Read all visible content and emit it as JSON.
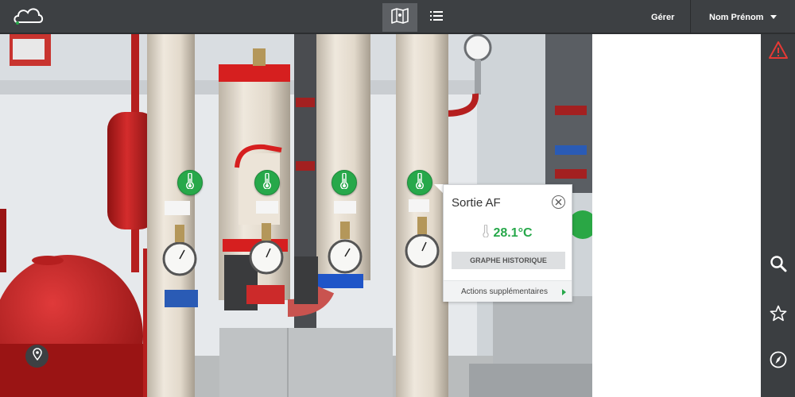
{
  "header": {
    "logo_icon": "cloud-icon",
    "views": [
      {
        "name": "map-view",
        "icon": "map-icon",
        "active": true
      },
      {
        "name": "list-view",
        "icon": "list-icon",
        "active": false
      }
    ],
    "manage_label": "Gérer",
    "user_name": "Nom Prénom",
    "user_menu_icon": "caret-down-icon"
  },
  "sidebar": {
    "items": [
      {
        "icon": "warning-icon",
        "color": "#e53935"
      },
      {
        "icon": "search-icon"
      },
      {
        "icon": "star-icon"
      },
      {
        "icon": "compass-icon"
      }
    ]
  },
  "markers": [
    {
      "icon": "thermometer-icon",
      "color": "#27a84a"
    },
    {
      "icon": "thermometer-icon",
      "color": "#27a84a"
    },
    {
      "icon": "thermometer-icon",
      "color": "#27a84a"
    },
    {
      "icon": "thermometer-icon",
      "color": "#27a84a"
    }
  ],
  "popup": {
    "title": "Sortie AF",
    "value": "28.1°C",
    "value_color": "#27a84a",
    "history_button": "GRAPHE HISTORIQUE",
    "more_actions": "Actions supplémentaires"
  },
  "location_button_icon": "location-pin-icon"
}
